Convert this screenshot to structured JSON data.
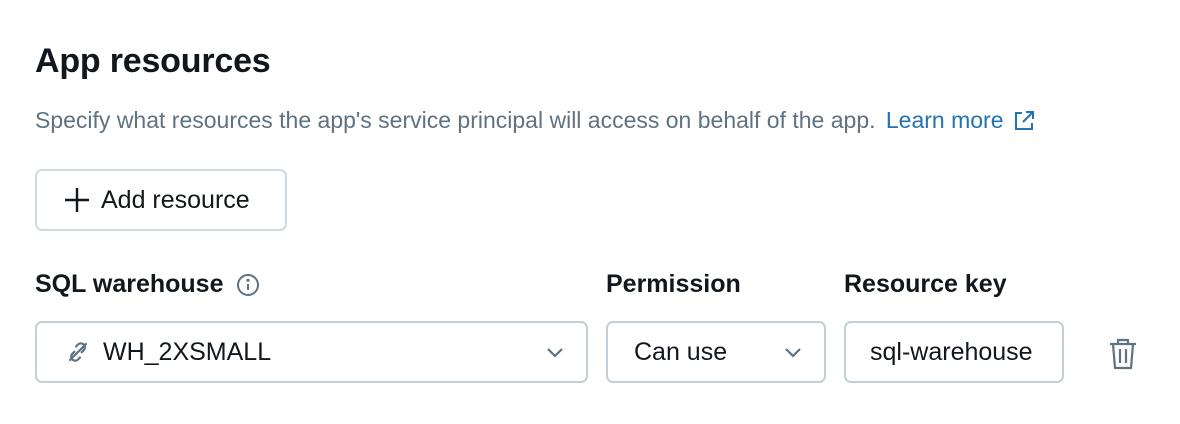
{
  "section": {
    "title": "App resources",
    "description": "Specify what resources the app's service principal will access on behalf of the app.",
    "learn_more_label": "Learn more"
  },
  "add_resource": {
    "label": "Add resource",
    "icon": "plus-icon"
  },
  "resource_row": {
    "warehouse_label": "SQL warehouse",
    "warehouse_info_icon": "info-icon",
    "warehouse_value": "WH_2XSMALL",
    "warehouse_icon": "disconnected-link-icon",
    "permission_label": "Permission",
    "permission_value": "Can use",
    "resource_key_label": "Resource key",
    "resource_key_value": "sql-warehouse",
    "delete_icon": "trash-icon"
  },
  "colors": {
    "text": "#11171c",
    "muted": "#5f7281",
    "link": "#2272b4",
    "border": "#c6ced6"
  }
}
